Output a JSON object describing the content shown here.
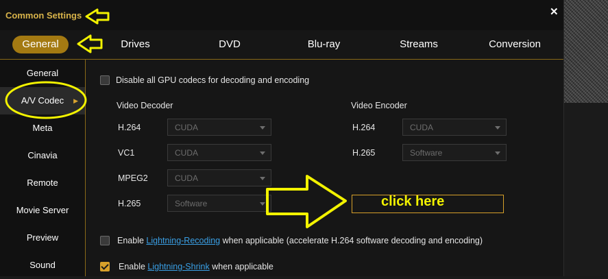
{
  "window": {
    "title": "Common Settings",
    "close_icon": "close-icon"
  },
  "top_tabs": [
    "General",
    "Drives",
    "DVD",
    "Blu-ray",
    "Streams",
    "Conversion"
  ],
  "sidebar": {
    "items": [
      "General",
      "A/V Codec",
      "Meta",
      "Cinavia",
      "Remote",
      "Movie Server",
      "Preview",
      "Sound"
    ]
  },
  "gpu": {
    "disable_label": "Disable all GPU codecs for decoding and encoding",
    "checked": false
  },
  "decoder": {
    "heading": "Video Decoder",
    "rows": [
      {
        "codec": "H.264",
        "value": "CUDA"
      },
      {
        "codec": "VC1",
        "value": "CUDA"
      },
      {
        "codec": "MPEG2",
        "value": "CUDA"
      },
      {
        "codec": "H.265",
        "value": "Software"
      }
    ]
  },
  "encoder": {
    "heading": "Video Encoder",
    "rows": [
      {
        "codec": "H.264",
        "value": "CUDA"
      },
      {
        "codec": "H.265",
        "value": "Software"
      }
    ]
  },
  "lightning_recoding": {
    "prefix": "Enable ",
    "link": "Lightning-Recoding",
    "suffix": " when applicable (accelerate H.264 software decoding and encoding)",
    "checked": false
  },
  "lightning_shrink": {
    "prefix": "Enable ",
    "link": "Lightning-Shrink",
    "suffix": " when applicable",
    "checked": true
  },
  "annotation": {
    "click_text": "click here",
    "color": "#f2f200"
  },
  "colors": {
    "accent": "#a47a12",
    "link": "#3aa0e6",
    "check": "#d7a02a"
  }
}
